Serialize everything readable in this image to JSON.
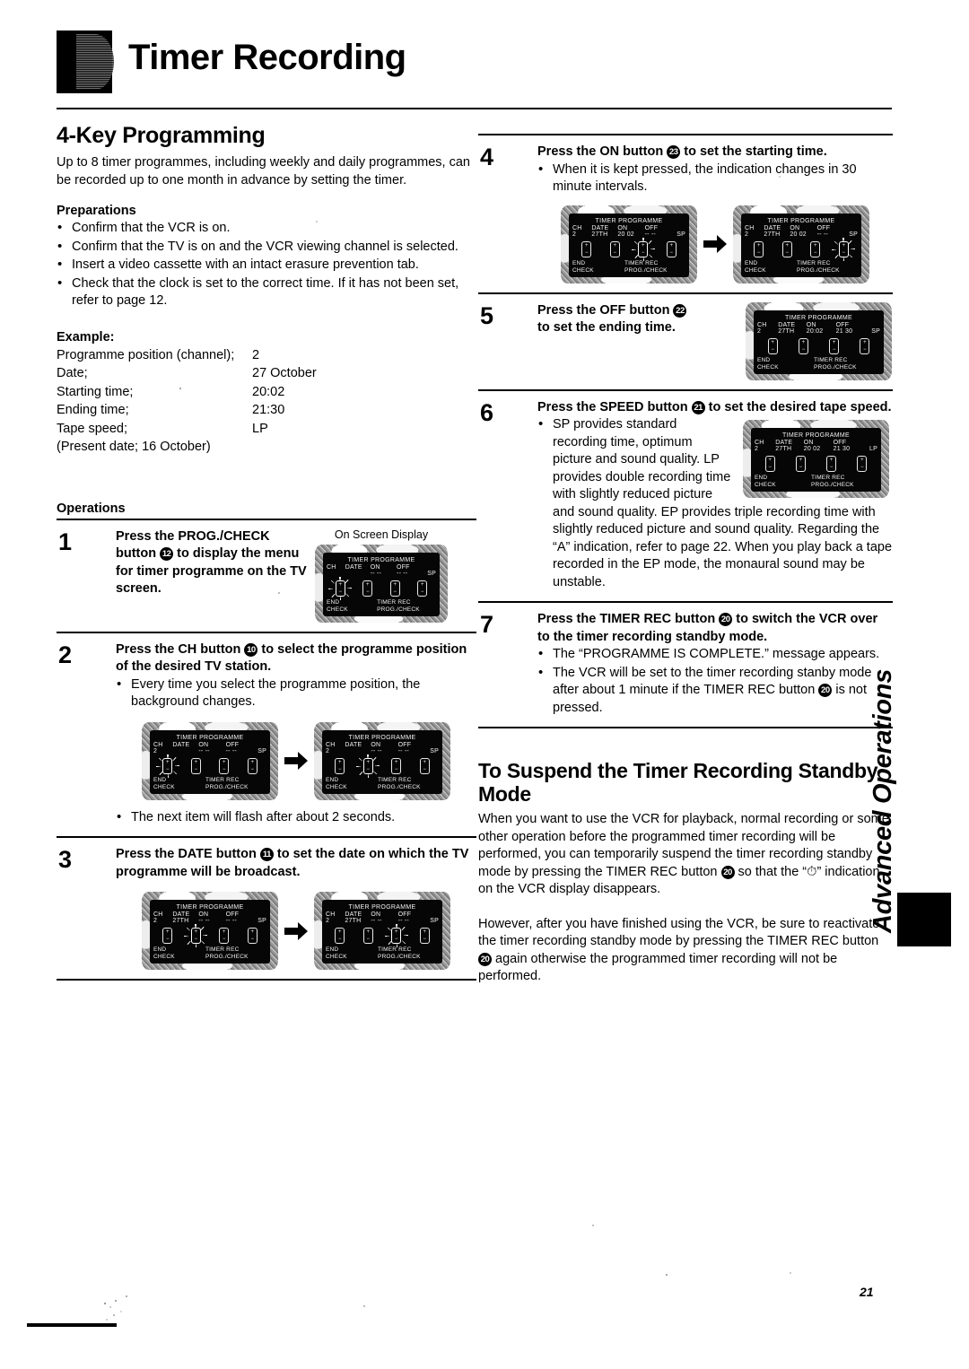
{
  "header": {
    "title": "Timer Recording",
    "badge_icon": "chapter-badge-icon"
  },
  "page_number": "21",
  "sidebar": {
    "label": "Advanced Operations",
    "tab_icon": "black-tab-marker"
  },
  "left": {
    "section_title": "4-Key Programming",
    "intro": "Up to 8 timer programmes, including weekly and daily programmes, can be recorded up to one month in advance by setting the timer.",
    "preparations_heading": "Preparations",
    "preparations": [
      "Confirm that the VCR is on.",
      "Confirm that the TV is on and the VCR viewing channel is selected.",
      "Insert a video cassette with an intact erasure prevention tab.",
      "Check that the clock is set to the correct time. If it has not been set, refer to page 12."
    ],
    "example_heading": "Example:",
    "example_rows": [
      {
        "label": "Programme position (channel);",
        "value": "2"
      },
      {
        "label": "Date;",
        "value": "27 October"
      },
      {
        "label": "Starting time;",
        "value": "20:02"
      },
      {
        "label": "Ending time;",
        "value": "21:30"
      },
      {
        "label": "Tape speed;",
        "value": "LP"
      }
    ],
    "example_note": "(Present date; 16 October)",
    "operations_heading": "Operations"
  },
  "steps": {
    "s1": {
      "num": "1",
      "lead_a": "Press the PROG./CHECK button ",
      "btn": "12",
      "lead_b": " to display the menu for timer programme on the TV screen.",
      "osd_caption": "On Screen Display"
    },
    "s2": {
      "num": "2",
      "lead_a": "Press the CH button ",
      "btn": "10",
      "lead_b": " to select the programme position of the desired TV station.",
      "bullets": [
        "Every time you select the programme position, the background changes."
      ],
      "note": "The next item will flash after about 2 seconds."
    },
    "s3": {
      "num": "3",
      "lead_a": "Press the DATE button ",
      "btn": "11",
      "lead_b": " to set the date on which the TV programme will be broadcast."
    },
    "s4": {
      "num": "4",
      "lead_a": "Press the ON button ",
      "btn": "23",
      "lead_b": " to set the starting time.",
      "bullets": [
        "When it is kept pressed, the indication changes in 30 minute intervals."
      ]
    },
    "s5": {
      "num": "5",
      "lead_a": "Press the OFF button ",
      "btn": "22",
      "lead_b": "",
      "lead_c": "to set the ending time."
    },
    "s6": {
      "num": "6",
      "lead_a": "Press the SPEED button ",
      "btn": "21",
      "lead_b": " to set the desired tape speed.",
      "bullets": [
        "SP provides standard recording time, optimum picture and sound quality. LP provides double recording time with slightly reduced picture and sound quality. EP provides triple recording time with slightly reduced picture and sound quality. Regarding the “A” indication, refer to page 22. When you play back a tape recorded in the EP mode, the monaural sound may be unstable."
      ]
    },
    "s7": {
      "num": "7",
      "lead_a": "Press the TIMER REC button ",
      "btn": "20",
      "lead_b": " to switch the VCR over to the timer recording standby mode.",
      "bullets_html": [
        "The “PROGRAMME IS COMPLETE.” message appears.",
        "The VCR will be set to the timer recording stanby mode after about 1 minute if the TIMER REC button ⓪ is not pressed."
      ],
      "bullet2_a": "The VCR will be set to the timer recording stanby mode after about 1 minute if the TIMER REC button ",
      "bullet2_btn": "20",
      "bullet2_b": " is not pressed."
    }
  },
  "suspend": {
    "heading": "To Suspend the Timer Recording Standby Mode",
    "para1_a": "When you want to use the VCR for playback, normal recording or some other operation before the programmed timer recording will be performed, you can temporarily suspend the timer recording standby mode by pressing the TIMER REC button ",
    "para1_btn": "20",
    "para1_b": " so that the “⏱” indication on the VCR display disappears.",
    "para2_a": "However, after you have finished using the VCR, be sure to reactivate the timer recording standby mode by pressing the TIMER REC button ",
    "para2_btn": "20",
    "para2_b": " again otherwise the programmed timer recording will not be performed."
  },
  "osd": {
    "title": "TIMER PROGRAMME",
    "columns": {
      "ch": "CH",
      "date": "DATE",
      "on": "ON",
      "off": "OFF"
    },
    "footer": {
      "end": "END",
      "check": "CHECK",
      "timer_rec": "TIMER REC",
      "prog_check": "PROG./CHECK"
    },
    "screens": {
      "s1": {
        "ch": "",
        "date": "",
        "on": "-- --",
        "off": "-- --",
        "sp": "SP",
        "flash": 0
      },
      "s2a": {
        "ch": "2",
        "date": "",
        "on": "-- --",
        "off": "-- --",
        "sp": "SP",
        "flash": 0
      },
      "s2b": {
        "ch": "2",
        "date": "",
        "on": "-- --",
        "off": "-- --",
        "sp": "SP",
        "flash": 1
      },
      "s3a": {
        "ch": "2",
        "date": "27TH",
        "on": "-- --",
        "off": "-- --",
        "sp": "SP",
        "flash": 1
      },
      "s3b": {
        "ch": "2",
        "date": "27TH",
        "on": "-- --",
        "off": "-- --",
        "sp": "SP",
        "flash": 2
      },
      "s4a": {
        "ch": "2",
        "date": "27TH",
        "on": "20 02",
        "off": "-- --",
        "sp": "SP",
        "flash": 2
      },
      "s4b": {
        "ch": "2",
        "date": "27TH",
        "on": "20 02",
        "off": "-- --",
        "sp": "SP",
        "flash": 3
      },
      "s5": {
        "ch": "2",
        "date": "27TH",
        "on": "20:02",
        "off": "21 30",
        "sp": "SP",
        "flash": -1
      },
      "s6": {
        "ch": "2",
        "date": "27TH",
        "on": "20 02",
        "off": "21 30",
        "sp": "LP",
        "flash": -1
      }
    }
  }
}
